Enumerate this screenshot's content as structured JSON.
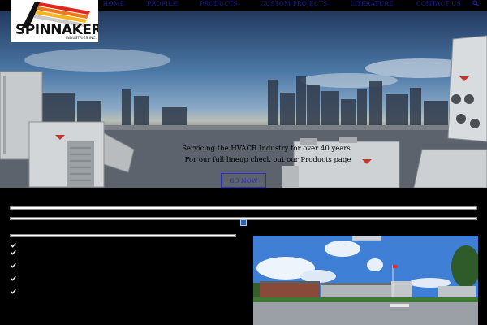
{
  "nav": {
    "items": [
      "HOME",
      "PROFILE",
      "PRODUCTS",
      "CUSTOM PROJECTS",
      "LITERATURE",
      "CONTACT US"
    ]
  },
  "logo": {
    "word": "SPINNAKER",
    "sub": "INDUSTRIES INC."
  },
  "hero": {
    "line1": "Servicing the HVACR Industry for over 40 years",
    "line2": "For our full lineup check out our Products page",
    "button": "GO NOW"
  },
  "colors": {
    "nav_link": "#1a1aa8",
    "button_border": "#2c2cc8",
    "background": "#000000"
  },
  "icons": [
    "search-icon",
    "check-icon",
    "broken-image-icon"
  ]
}
